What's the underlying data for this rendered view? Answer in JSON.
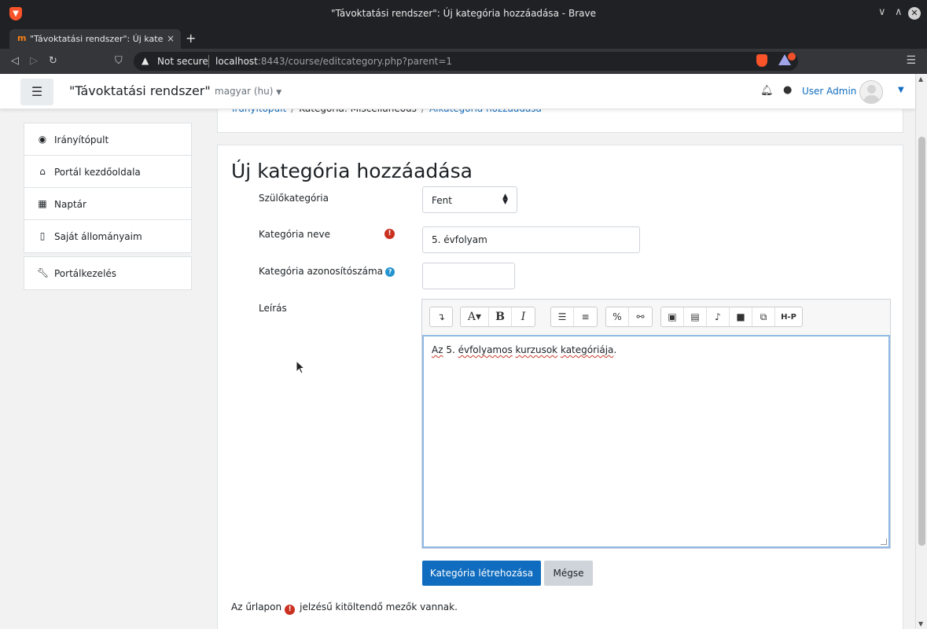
{
  "window": {
    "title": "\"Távoktatási rendszer\": Új kategória hozzáadása - Brave",
    "tab_label": "\"Távoktatási rendszer\": Új kate",
    "tab_close": "×",
    "new_tab": "+",
    "ctrl_minimize": "∨",
    "ctrl_maximize": "∧",
    "ctrl_close": "✕"
  },
  "address_bar": {
    "not_secure": "Not secure",
    "host": "localhost",
    "rest": ":8443/course/editcategory.php?parent=1"
  },
  "navbar": {
    "site_name": "\"Távoktatási rendszer\"",
    "language": "magyar (hu)",
    "user_name": "User Admin"
  },
  "sidebar": {
    "items": [
      {
        "label": "Irányítópult",
        "icon": "dashboard-icon"
      },
      {
        "label": "Portál kezdőoldala",
        "icon": "home-icon"
      },
      {
        "label": "Naptár",
        "icon": "calendar-icon"
      },
      {
        "label": "Saját állományaim",
        "icon": "file-icon"
      }
    ],
    "admin": {
      "label": "Portálkezelés",
      "icon": "wrench-icon"
    }
  },
  "breadcrumb": {
    "items": [
      "Irányítópult",
      "Kategória: Miscellaneous",
      "Alkategória hozzáadása"
    ]
  },
  "form": {
    "title": "Új kategória hozzáadása",
    "parent_label": "Szülőkategória",
    "parent_value": "Fent",
    "name_label": "Kategória neve",
    "name_value": "5. évfolyam",
    "idnumber_label": "Kategória azonosítószáma",
    "idnumber_value": "",
    "description_label": "Leírás",
    "description_text": {
      "w1": "Az",
      "w2": " 5. ",
      "w3": "évfolyamos",
      "w4": " ",
      "w5": "kurzusok",
      "w6": " ",
      "w7": "kategóriája",
      "w8": "."
    },
    "submit_label": "Kategória létrehozása",
    "cancel_label": "Mégse",
    "required_note_before": "Az űrlapon",
    "required_note_after": "jelzésű kitöltendő mezők vannak."
  },
  "colors": {
    "primary": "#0f6cbf",
    "required": "#ca3120",
    "help": "#2593d0"
  }
}
